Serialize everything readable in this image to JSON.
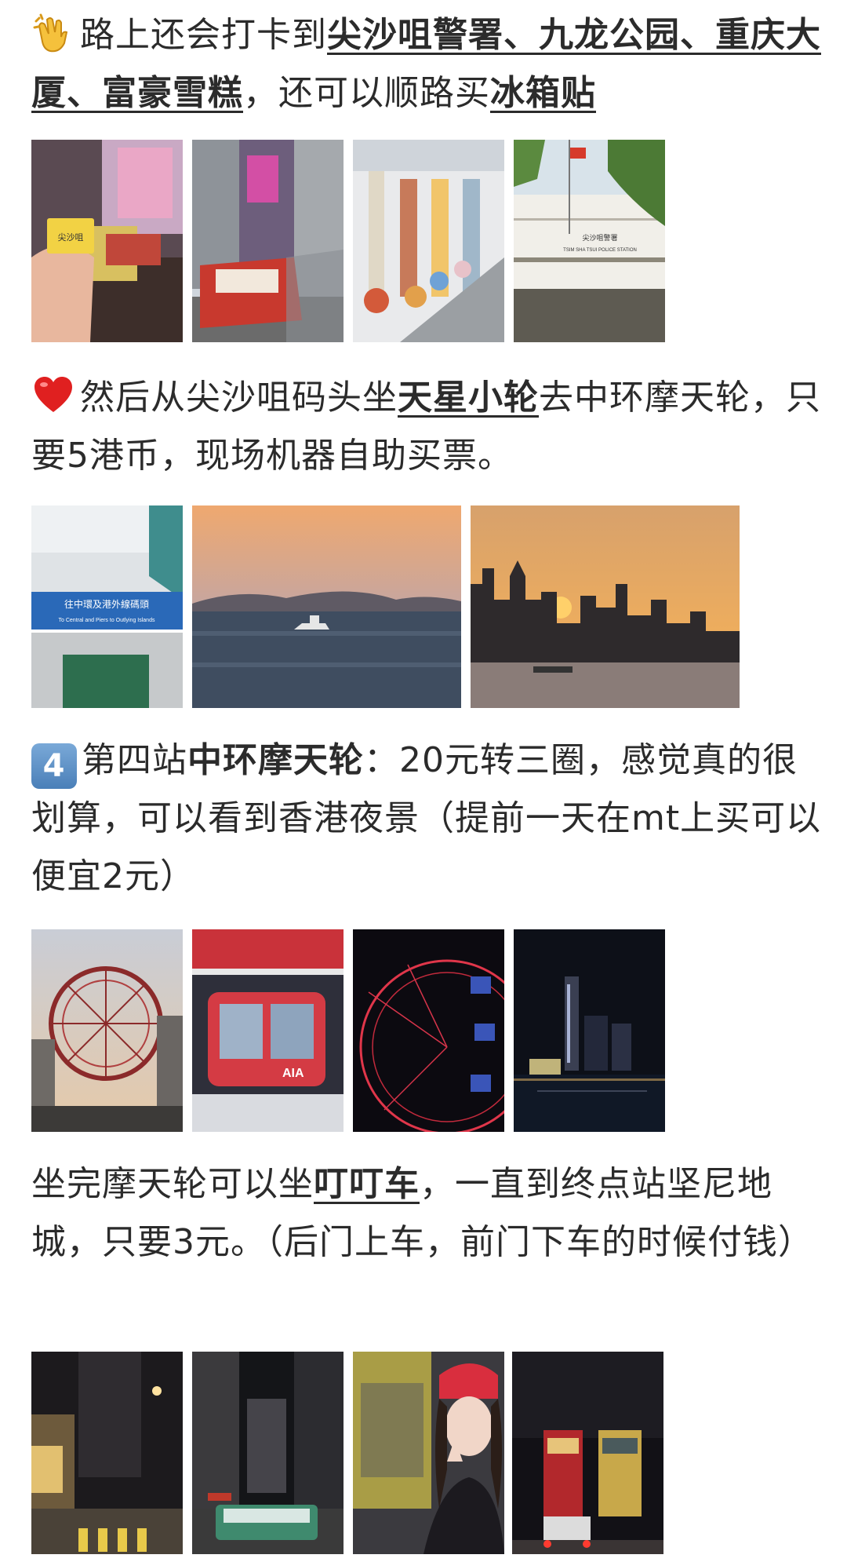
{
  "p1": {
    "pre": "路上还会打卡到",
    "k1": "尖沙咀警署、九龙公园、重庆大厦、富豪雪糕",
    "mid": "，还可以顺路买",
    "k2": "冰箱贴"
  },
  "p2": {
    "pre": "然后从尖沙咀码头坐",
    "k1": "天星小轮",
    "post": "去中环摩天轮，只要5港币，现场机器自助买票。"
  },
  "p3": {
    "badge": "4",
    "pre": "第四站",
    "k1": "中环摩天轮",
    "post": "：20元转三圈，感觉真的很划算，可以看到香港夜景（提前一天在mt上买可以便宜2元）"
  },
  "p4": {
    "pre": "坐完摩天轮可以坐",
    "k1": "叮叮车",
    "post": "，一直到终点站坚尼地城，只要3元。（后门上车，前门下车的时候付钱）"
  },
  "photo_text": {
    "souvenir": "尖沙咀",
    "police_cn": "尖沙咀警署",
    "police_en": "TSIM SHA TSUI POLICE STATION",
    "ferry_sign_cn": "往中環及港外線碼頭",
    "ferry_sign_en": "To Central and Piers to Outlying Islands",
    "aia": "AIA"
  },
  "icons": {
    "p1": "clapping-hands-icon",
    "p2": "red-heart-icon",
    "p3": "keycap-four-icon"
  }
}
